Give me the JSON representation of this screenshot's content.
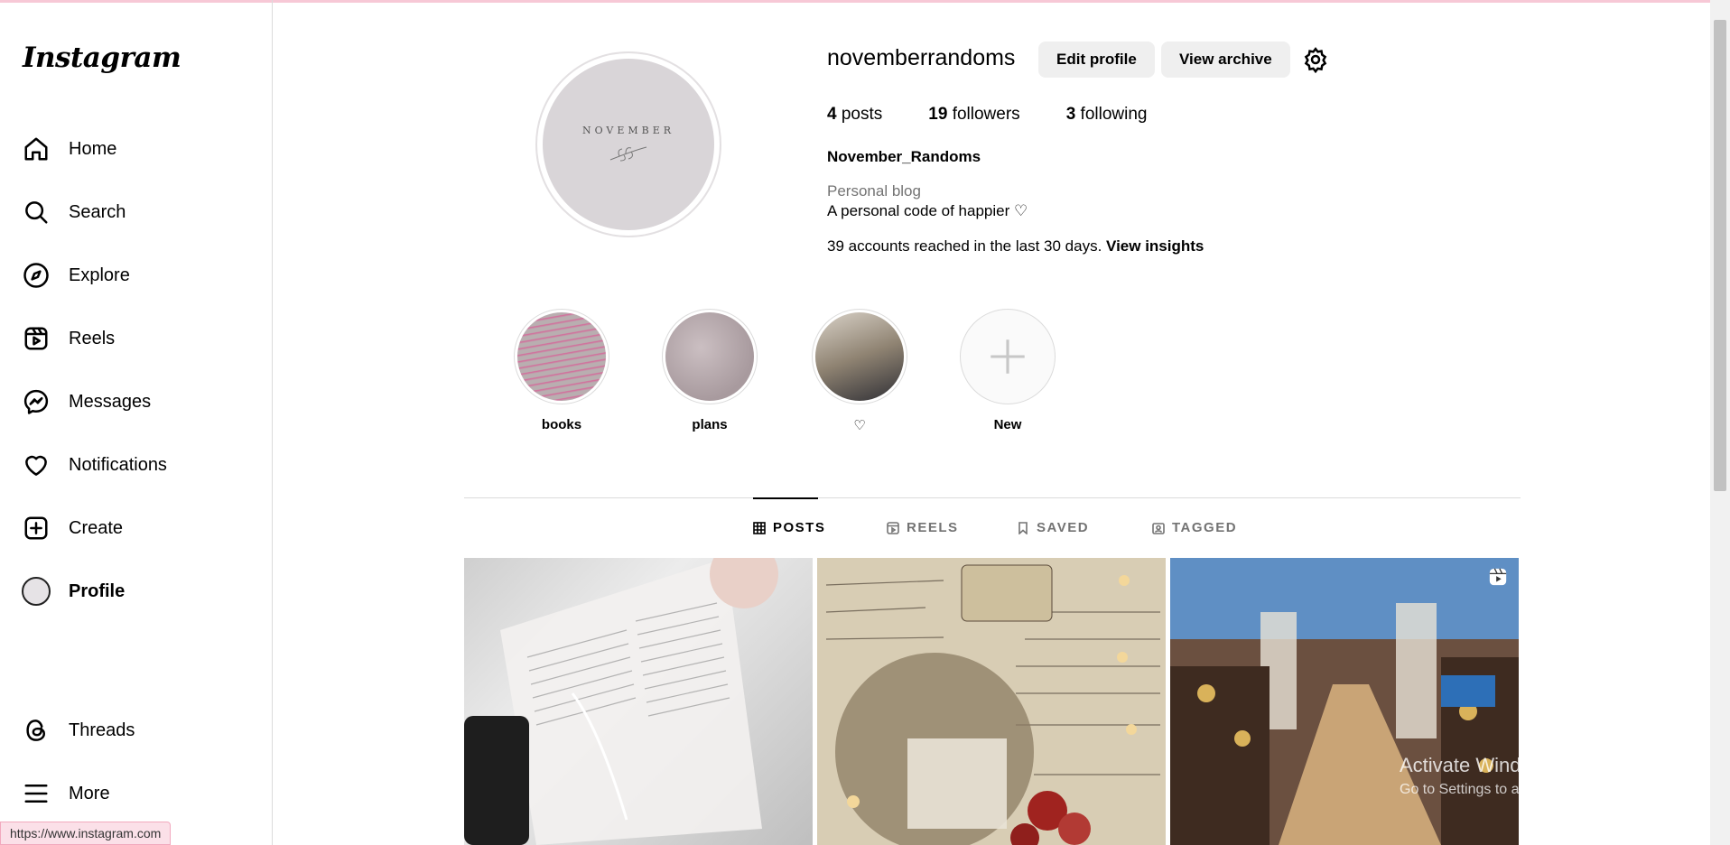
{
  "app": {
    "logo": "Instagram",
    "status_url": "https://www.instagram.com"
  },
  "sidebar": {
    "items": [
      {
        "label": "Home",
        "icon": "home-icon"
      },
      {
        "label": "Search",
        "icon": "search-icon"
      },
      {
        "label": "Explore",
        "icon": "compass-icon"
      },
      {
        "label": "Reels",
        "icon": "reels-icon"
      },
      {
        "label": "Messages",
        "icon": "messenger-icon"
      },
      {
        "label": "Notifications",
        "icon": "heart-icon"
      },
      {
        "label": "Create",
        "icon": "plus-square-icon"
      },
      {
        "label": "Profile",
        "icon": "avatar"
      }
    ],
    "bottom": [
      {
        "label": "Threads",
        "icon": "threads-icon"
      },
      {
        "label": "More",
        "icon": "menu-icon"
      }
    ]
  },
  "profile": {
    "avatar_text": "NOVEMBER",
    "username": "novemberrandoms",
    "edit_label": "Edit profile",
    "archive_label": "View archive",
    "posts_count": "4",
    "posts_label": "posts",
    "followers_count": "19",
    "followers_label": "followers",
    "following_count": "3",
    "following_label": "following",
    "full_name": "November_Randoms",
    "category": "Personal blog",
    "bio": "A personal code of happier ♡",
    "insights_text": "39 accounts reached in the last 30 days.",
    "insights_link": "View insights"
  },
  "highlights": [
    {
      "name": "books"
    },
    {
      "name": "plans"
    },
    {
      "name": "♡"
    },
    {
      "name": "New"
    }
  ],
  "tabs": [
    {
      "label": "POSTS",
      "icon": "grid-icon"
    },
    {
      "label": "REELS",
      "icon": "reels-icon"
    },
    {
      "label": "SAVED",
      "icon": "bookmark-icon"
    },
    {
      "label": "TAGGED",
      "icon": "tag-icon"
    }
  ],
  "watermark": {
    "title": "Activate Windows",
    "subtitle": "Go to Settings to activate Windows."
  }
}
